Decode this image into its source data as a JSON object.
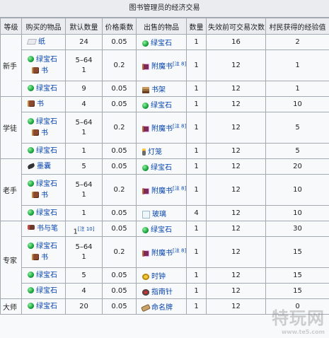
{
  "title": "图书管理员的经济交易",
  "headers": [
    "等级",
    "购买的物品",
    "默认数量",
    "价格乘数",
    "出售的物品",
    "数量",
    "失效前可交易次数",
    "村民获得的经验值"
  ],
  "levels": {
    "novice": "新手",
    "apprentice": "学徒",
    "journeyman": "老手",
    "expert": "专家",
    "master": "大师"
  },
  "rows": [
    {
      "buy": [
        {
          "icon": "paper-icon",
          "name": "纸"
        }
      ],
      "count": [
        "24"
      ],
      "mult": "0.05",
      "sell": {
        "icon": "emerald-icon",
        "name": "绿宝石"
      },
      "qty": "1",
      "uses": "16",
      "xp": "2"
    },
    {
      "buy": [
        {
          "icon": "emerald-icon",
          "name": "绿宝石"
        },
        {
          "icon": "book-icon",
          "name": "书"
        }
      ],
      "count": [
        "5–64",
        "1"
      ],
      "mult": "0.2",
      "sell": {
        "icon": "enchanted-book-icon",
        "name": "附魔书",
        "note": "[注 8]"
      },
      "qty": "1",
      "uses": "12",
      "xp": "1"
    },
    {
      "buy": [
        {
          "icon": "emerald-icon",
          "name": "绿宝石"
        }
      ],
      "count": [
        "9"
      ],
      "mult": "0.05",
      "sell": {
        "icon": "bookshelf-icon",
        "name": "书架"
      },
      "qty": "1",
      "uses": "12",
      "xp": "1"
    },
    {
      "buy": [
        {
          "icon": "book-icon",
          "name": "书"
        }
      ],
      "count": [
        "4"
      ],
      "mult": "0.05",
      "sell": {
        "icon": "emerald-icon",
        "name": "绿宝石"
      },
      "qty": "1",
      "uses": "12",
      "xp": "10"
    },
    {
      "buy": [
        {
          "icon": "emerald-icon",
          "name": "绿宝石"
        },
        {
          "icon": "book-icon",
          "name": "书"
        }
      ],
      "count": [
        "5–64",
        "1"
      ],
      "mult": "0.2",
      "sell": {
        "icon": "enchanted-book-icon",
        "name": "附魔书",
        "note": "[注 8]"
      },
      "qty": "1",
      "uses": "12",
      "xp": "5"
    },
    {
      "buy": [
        {
          "icon": "emerald-icon",
          "name": "绿宝石"
        }
      ],
      "count": [
        "1"
      ],
      "mult": "0.05",
      "sell": {
        "icon": "lantern-icon",
        "name": "灯笼"
      },
      "qty": "1",
      "uses": "12",
      "xp": "5"
    },
    {
      "buy": [
        {
          "icon": "ink-sac-icon",
          "name": "墨囊"
        }
      ],
      "count": [
        "5"
      ],
      "mult": "0.05",
      "sell": {
        "icon": "emerald-icon",
        "name": "绿宝石"
      },
      "qty": "1",
      "uses": "12",
      "xp": "20"
    },
    {
      "buy": [
        {
          "icon": "emerald-icon",
          "name": "绿宝石"
        },
        {
          "icon": "book-icon",
          "name": "书"
        }
      ],
      "count": [
        "5–64",
        "1"
      ],
      "mult": "0.2",
      "sell": {
        "icon": "enchanted-book-icon",
        "name": "附魔书",
        "note": "[注 8]"
      },
      "qty": "1",
      "uses": "12",
      "xp": "10"
    },
    {
      "buy": [
        {
          "icon": "emerald-icon",
          "name": "绿宝石"
        }
      ],
      "count": [
        "1"
      ],
      "mult": "0.05",
      "sell": {
        "icon": "glass-icon",
        "name": "玻璃"
      },
      "qty": "4",
      "uses": "12",
      "xp": "10"
    },
    {
      "buy": [
        {
          "icon": "book-and-quill-icon",
          "name": "书与笔"
        }
      ],
      "count": [
        "1"
      ],
      "countNote": "[注 10]",
      "mult": "0.05",
      "sell": {
        "icon": "emerald-icon",
        "name": "绿宝石"
      },
      "qty": "1",
      "uses": "12",
      "xp": "30"
    },
    {
      "buy": [
        {
          "icon": "emerald-icon",
          "name": "绿宝石"
        },
        {
          "icon": "book-icon",
          "name": "书"
        }
      ],
      "count": [
        "5–64",
        "1"
      ],
      "mult": "0.2",
      "sell": {
        "icon": "enchanted-book-icon",
        "name": "附魔书",
        "note": "[注 8]"
      },
      "qty": "1",
      "uses": "12",
      "xp": "15"
    },
    {
      "buy": [
        {
          "icon": "emerald-icon",
          "name": "绿宝石"
        }
      ],
      "count": [
        "5"
      ],
      "mult": "0.05",
      "sell": {
        "icon": "clock-icon",
        "name": "时钟"
      },
      "qty": "1",
      "uses": "12",
      "xp": "15"
    },
    {
      "buy": [
        {
          "icon": "emerald-icon",
          "name": "绿宝石"
        }
      ],
      "count": [
        "4"
      ],
      "mult": "0.05",
      "sell": {
        "icon": "compass-icon",
        "name": "指南针"
      },
      "qty": "1",
      "uses": "12",
      "xp": "15"
    },
    {
      "buy": [
        {
          "icon": "emerald-icon",
          "name": "绿宝石"
        }
      ],
      "count": [
        "20"
      ],
      "mult": "0.05",
      "sell": {
        "icon": "name-tag-icon",
        "name": "命名牌"
      },
      "qty": "1",
      "uses": "12",
      "xp": "0"
    }
  ],
  "watermark": {
    "main": "特玩网",
    "sub": "www.te5.com"
  }
}
